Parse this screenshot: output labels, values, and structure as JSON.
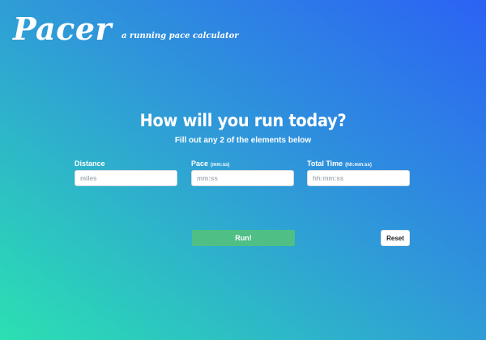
{
  "app": {
    "logo": "Pacer",
    "tagline": "a running pace calculator"
  },
  "main": {
    "heading": "How will you run today?",
    "subheading": "Fill out any 2 of the elements below"
  },
  "fields": [
    {
      "label": "Distance",
      "hint": "",
      "placeholder": "miles",
      "value": ""
    },
    {
      "label": "Pace",
      "hint": "(mm:ss)",
      "placeholder": "mm:ss",
      "value": ""
    },
    {
      "label": "Total Time",
      "hint": "(hh:mm:ss)",
      "placeholder": "hh:mm:ss",
      "value": ""
    }
  ],
  "actions": {
    "run_label": "Run!",
    "reset_label": "Reset"
  },
  "colors": {
    "gradient_top_right": "#2b62f4",
    "gradient_bottom_left": "#2be0b2",
    "run_button": "#4fbf85"
  }
}
